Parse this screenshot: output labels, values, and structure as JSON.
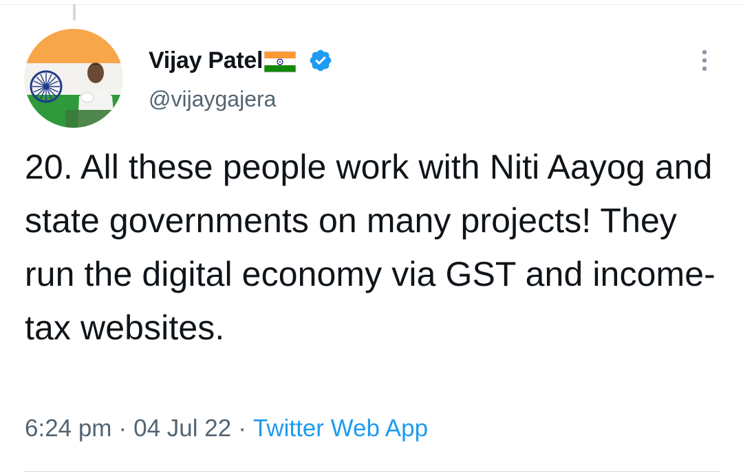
{
  "tweet": {
    "author": {
      "display_name": "Vijay Patel",
      "flag_icon": "india-flag-icon",
      "verified": true,
      "handle": "@vijaygajera"
    },
    "text": "20. All these people work with Niti Aayog and state governments on many projects! They run the digital economy via GST and income-tax websites.",
    "time": "6:24 pm",
    "date": "04 Jul 22",
    "source": "Twitter Web App",
    "separator": "·"
  },
  "colors": {
    "text": "#0f1419",
    "secondary": "#536471",
    "link": "#1d9bf0",
    "verified": "#1d9bf0",
    "saffron": "#ff9933",
    "green": "#138808",
    "chakra": "#000080"
  }
}
